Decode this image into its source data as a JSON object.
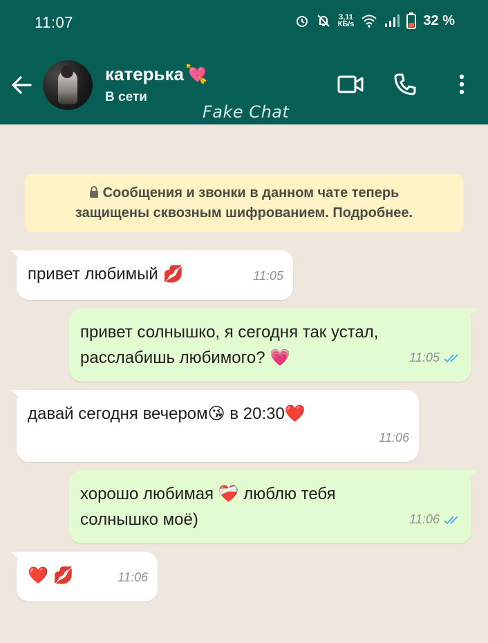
{
  "status_bar": {
    "time": "11:07",
    "net_speed_value": "3,11",
    "net_speed_unit": "КБ/s",
    "battery": "32 %",
    "icons": [
      "alarm-icon",
      "mute-icon",
      "wifi-icon",
      "signal-icon",
      "battery-icon"
    ]
  },
  "header": {
    "contact_name": "катерька",
    "name_emoji": "💘",
    "status": "В сети",
    "watermark": "Fake Chat",
    "icons": [
      "back-arrow-icon",
      "video-call-icon",
      "phone-icon",
      "more-vert-icon"
    ]
  },
  "chat": {
    "encryption_notice_line1": "Сообщения и звонки в данном чате теперь",
    "encryption_notice_line2": "защищены сквозным шифрованием. Подробнее.",
    "messages": [
      {
        "direction": "in",
        "text": "привет любимый",
        "emoji": "💋",
        "time": "11:05"
      },
      {
        "direction": "out",
        "line1": "привет солнышко, я сегодня так устал,",
        "line2": "расслабишь любимого?",
        "emoji": "💗",
        "time": "11:05",
        "status": "read"
      },
      {
        "direction": "in",
        "text_a": "давай сегодня вечером",
        "emoji_a": "😘",
        "text_b": "в 20:30",
        "emoji_b": "❤️",
        "time": "11:06"
      },
      {
        "direction": "out",
        "text_a": "хорошо любимая",
        "emoji_a": "❤️‍🩹",
        "text_b": "люблю тебя",
        "line2": "солнышко моё)",
        "time": "11:06",
        "status": "read"
      },
      {
        "direction": "in",
        "emoji_a": "❤️",
        "emoji_b": "💋",
        "time": "11:06"
      }
    ]
  },
  "colors": {
    "header": "#075e54",
    "chat_background": "#efe7de",
    "incoming_bubble": "#ffffff",
    "outgoing_bubble": "#e2fbd1",
    "notice_background": "#fdf3c5",
    "read_ticks": "#4fb3e8"
  }
}
